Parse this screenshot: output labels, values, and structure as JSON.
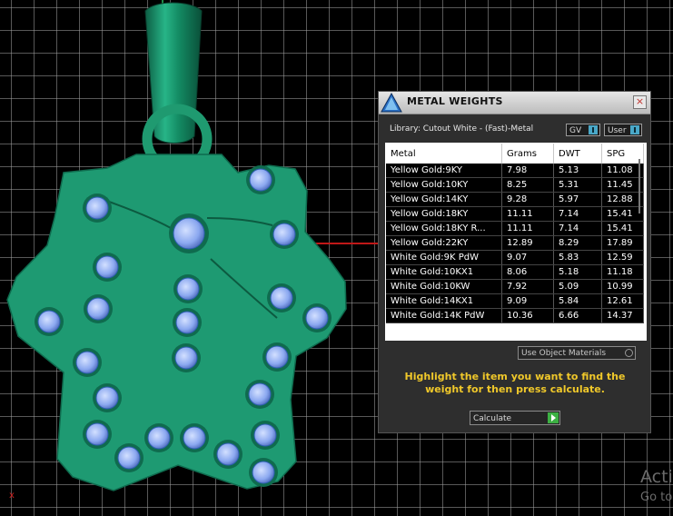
{
  "viewport": {
    "axis_label": "x",
    "background_notice": [
      "Acti",
      "Go to"
    ]
  },
  "panel": {
    "title": "METAL WEIGHTS",
    "close_label": "×",
    "library_label": "Library: Cutout White - (Fast)-Metal",
    "gv_label": "GV",
    "user_label": "User",
    "table": {
      "headers": [
        "Metal",
        "Grams",
        "DWT",
        "SPG"
      ],
      "rows": [
        [
          "Yellow Gold:9KY",
          "7.98",
          "5.13",
          "11.08"
        ],
        [
          "Yellow Gold:10KY",
          "8.25",
          "5.31",
          "11.45"
        ],
        [
          "Yellow Gold:14KY",
          "9.28",
          "5.97",
          "12.88"
        ],
        [
          "Yellow Gold:18KY",
          "11.11",
          "7.14",
          "15.41"
        ],
        [
          "Yellow Gold:18KY R...",
          "11.11",
          "7.14",
          "15.41"
        ],
        [
          "Yellow Gold:22KY",
          "12.89",
          "8.29",
          "17.89"
        ],
        [
          "White Gold:9K PdW",
          "9.07",
          "5.83",
          "12.59"
        ],
        [
          "White Gold:10KX1",
          "8.06",
          "5.18",
          "11.18"
        ],
        [
          "White Gold:10KW",
          "7.92",
          "5.09",
          "10.99"
        ],
        [
          "White Gold:14KX1",
          "9.09",
          "5.84",
          "12.61"
        ],
        [
          "White Gold:14K PdW",
          "10.36",
          "6.66",
          "14.37"
        ]
      ]
    },
    "use_object_materials": "Use Object Materials",
    "hint": "Highlight the item you want to find the weight for then press calculate.",
    "calculate_label": "Calculate"
  },
  "colors": {
    "metal": "#1e9a72",
    "gem": "#8fb0f5",
    "hint": "#f0c82a"
  }
}
